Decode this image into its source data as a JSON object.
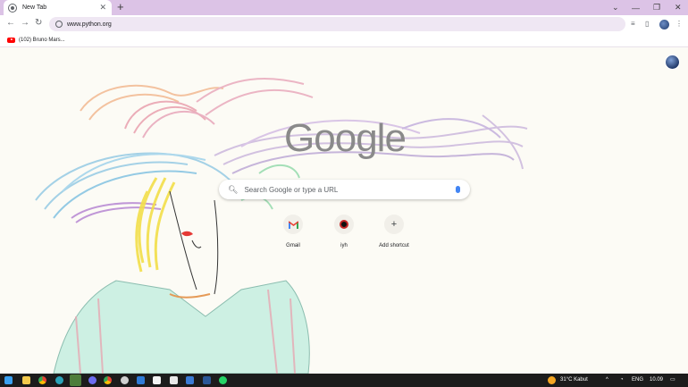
{
  "browser": {
    "tab": {
      "title": "New Tab",
      "favicon": "chrome-favicon-icon"
    },
    "new_tab": "+",
    "window_controls": {
      "dropdown": "⌄",
      "minimize": "—",
      "restore": "❐",
      "close": "✕"
    },
    "omnibox": {
      "url": "www.python.org"
    },
    "bookmarks": [
      {
        "label": "(102) Bruno Mars..."
      }
    ]
  },
  "newtab_page": {
    "logo": "Google",
    "search_placeholder": "Search Google or type a URL",
    "shortcuts": [
      {
        "label": "Gmail",
        "icon": "gmail-icon"
      },
      {
        "label": "iyh",
        "icon": "site-icon"
      },
      {
        "label": "Add shortcut",
        "icon": "plus-icon",
        "glyph": "+"
      }
    ]
  },
  "taskbar": {
    "weather": "31°C  Kabut",
    "language": "ENG",
    "time": "10.09"
  },
  "colors": {
    "tab_strip": "#dcc3e6",
    "omnibox": "#efe7f3",
    "taskbar": "#1c1c1c",
    "google_gray": "#8a8a8a"
  }
}
